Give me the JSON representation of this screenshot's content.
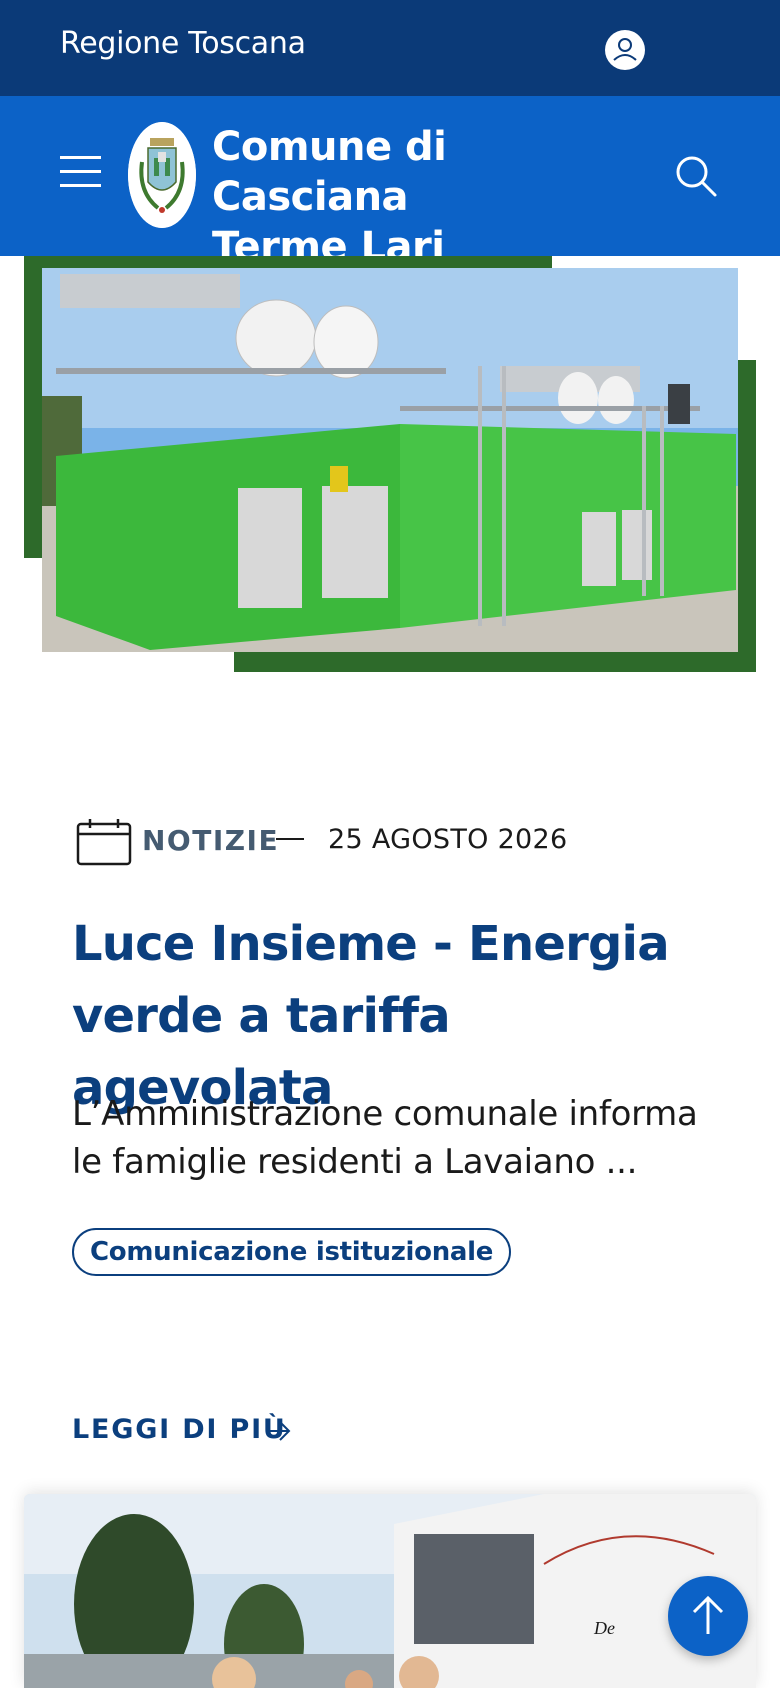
{
  "topbar": {
    "region_label": "Regione Toscana",
    "user_icon": "user-icon"
  },
  "header": {
    "menu_icon": "hamburger-menu-icon",
    "logo": "municipal-coat-of-arms",
    "title_line1": "Comune di Casciana",
    "title_line2": "Terme Lari",
    "search_icon": "search-icon"
  },
  "article": {
    "category_icon": "calendar-icon",
    "category": "NOTIZIE",
    "separator": "—",
    "date": "25 AGOSTO 2026",
    "title": "Luce Insieme - Energia verde a tariffa agevolata",
    "description": "L’Amministrazione comunale informa le famiglie residenti a Lavaiano ...",
    "tag": "Comunicazione istituzionale",
    "read_more": "LEGGI DI PIÙ",
    "read_more_icon": "arrow-right-icon"
  },
  "back_to_top_icon": "arrow-up-icon",
  "colors": {
    "topbar": "#0b3a78",
    "header": "#0c62c7",
    "title": "#0b3f7e",
    "hero_frame": "#2d6a2a"
  }
}
